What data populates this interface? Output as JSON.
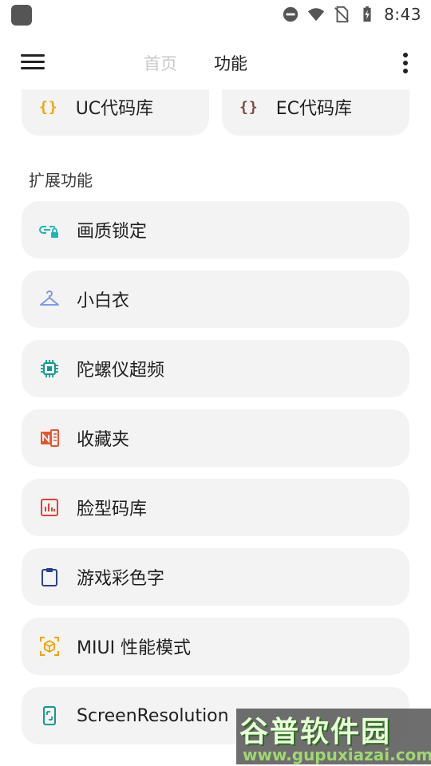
{
  "status_bar": {
    "time": "8:43",
    "icons": [
      "app-notification-icon",
      "dnd-icon",
      "wifi-icon",
      "no-sim-icon",
      "battery-charging-icon"
    ]
  },
  "app_bar": {
    "tabs": [
      {
        "label": "首页",
        "active": false
      },
      {
        "label": "功能",
        "active": true
      }
    ],
    "menu_icon": "hamburger-menu-icon",
    "more_icon": "more-vertical-icon"
  },
  "top_cards": [
    {
      "icon": "code-braces-icon",
      "icon_text": "{}",
      "icon_color": "#f0a300",
      "label": "UC代码库"
    },
    {
      "icon": "code-braces-icon",
      "icon_text": "{}",
      "icon_color": "#7a4a3a",
      "label": "EC代码库"
    }
  ],
  "section": {
    "title": "扩展功能"
  },
  "items": [
    {
      "icon": "link-lock-icon",
      "icon_color": "#1fb5b5",
      "label": "画质锁定"
    },
    {
      "icon": "hanger-icon",
      "icon_color": "#7a9ce6",
      "label": "小白衣"
    },
    {
      "icon": "chip-icon",
      "icon_color": "#109b8f",
      "label": "陀螺仪超频"
    },
    {
      "icon": "notebook-icon",
      "icon_color": "#e8552e",
      "label": "收藏夹"
    },
    {
      "icon": "bar-chart-icon",
      "icon_color": "#d9443a",
      "label": "脸型码库"
    },
    {
      "icon": "clipboard-icon",
      "icon_color": "#2c3f8f",
      "label": "游戏彩色字"
    },
    {
      "icon": "cube-icon",
      "icon_color": "#f0a300",
      "label": "MIUI 性能模式"
    },
    {
      "icon": "phone-screen-icon",
      "icon_color": "#139a8c",
      "label": "ScreenResolution"
    }
  ],
  "watermark": {
    "logo": "谷普软件园",
    "url": "www.gupuxiazai.com"
  }
}
